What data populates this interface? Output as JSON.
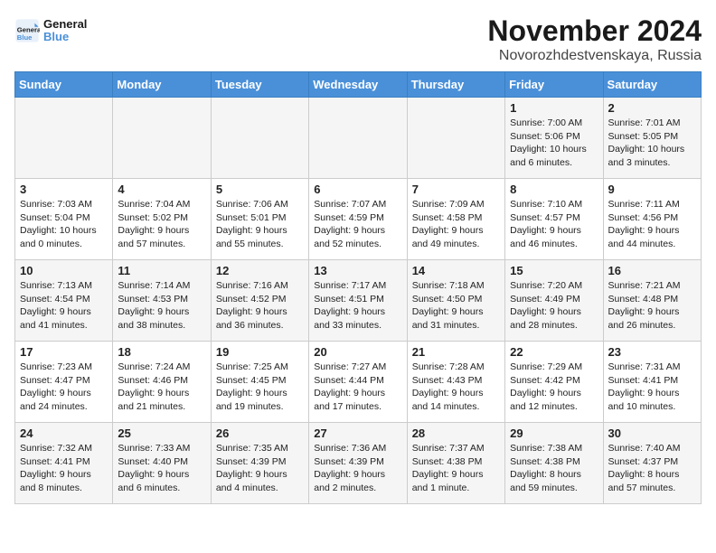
{
  "header": {
    "title": "November 2024",
    "subtitle": "Novorozhdestvenskaya, Russia",
    "logo_line1": "General",
    "logo_line2": "Blue"
  },
  "days_of_week": [
    "Sunday",
    "Monday",
    "Tuesday",
    "Wednesday",
    "Thursday",
    "Friday",
    "Saturday"
  ],
  "weeks": [
    [
      {
        "day": "",
        "info": ""
      },
      {
        "day": "",
        "info": ""
      },
      {
        "day": "",
        "info": ""
      },
      {
        "day": "",
        "info": ""
      },
      {
        "day": "",
        "info": ""
      },
      {
        "day": "1",
        "info": "Sunrise: 7:00 AM\nSunset: 5:06 PM\nDaylight: 10 hours\nand 6 minutes."
      },
      {
        "day": "2",
        "info": "Sunrise: 7:01 AM\nSunset: 5:05 PM\nDaylight: 10 hours\nand 3 minutes."
      }
    ],
    [
      {
        "day": "3",
        "info": "Sunrise: 7:03 AM\nSunset: 5:04 PM\nDaylight: 10 hours\nand 0 minutes."
      },
      {
        "day": "4",
        "info": "Sunrise: 7:04 AM\nSunset: 5:02 PM\nDaylight: 9 hours\nand 57 minutes."
      },
      {
        "day": "5",
        "info": "Sunrise: 7:06 AM\nSunset: 5:01 PM\nDaylight: 9 hours\nand 55 minutes."
      },
      {
        "day": "6",
        "info": "Sunrise: 7:07 AM\nSunset: 4:59 PM\nDaylight: 9 hours\nand 52 minutes."
      },
      {
        "day": "7",
        "info": "Sunrise: 7:09 AM\nSunset: 4:58 PM\nDaylight: 9 hours\nand 49 minutes."
      },
      {
        "day": "8",
        "info": "Sunrise: 7:10 AM\nSunset: 4:57 PM\nDaylight: 9 hours\nand 46 minutes."
      },
      {
        "day": "9",
        "info": "Sunrise: 7:11 AM\nSunset: 4:56 PM\nDaylight: 9 hours\nand 44 minutes."
      }
    ],
    [
      {
        "day": "10",
        "info": "Sunrise: 7:13 AM\nSunset: 4:54 PM\nDaylight: 9 hours\nand 41 minutes."
      },
      {
        "day": "11",
        "info": "Sunrise: 7:14 AM\nSunset: 4:53 PM\nDaylight: 9 hours\nand 38 minutes."
      },
      {
        "day": "12",
        "info": "Sunrise: 7:16 AM\nSunset: 4:52 PM\nDaylight: 9 hours\nand 36 minutes."
      },
      {
        "day": "13",
        "info": "Sunrise: 7:17 AM\nSunset: 4:51 PM\nDaylight: 9 hours\nand 33 minutes."
      },
      {
        "day": "14",
        "info": "Sunrise: 7:18 AM\nSunset: 4:50 PM\nDaylight: 9 hours\nand 31 minutes."
      },
      {
        "day": "15",
        "info": "Sunrise: 7:20 AM\nSunset: 4:49 PM\nDaylight: 9 hours\nand 28 minutes."
      },
      {
        "day": "16",
        "info": "Sunrise: 7:21 AM\nSunset: 4:48 PM\nDaylight: 9 hours\nand 26 minutes."
      }
    ],
    [
      {
        "day": "17",
        "info": "Sunrise: 7:23 AM\nSunset: 4:47 PM\nDaylight: 9 hours\nand 24 minutes."
      },
      {
        "day": "18",
        "info": "Sunrise: 7:24 AM\nSunset: 4:46 PM\nDaylight: 9 hours\nand 21 minutes."
      },
      {
        "day": "19",
        "info": "Sunrise: 7:25 AM\nSunset: 4:45 PM\nDaylight: 9 hours\nand 19 minutes."
      },
      {
        "day": "20",
        "info": "Sunrise: 7:27 AM\nSunset: 4:44 PM\nDaylight: 9 hours\nand 17 minutes."
      },
      {
        "day": "21",
        "info": "Sunrise: 7:28 AM\nSunset: 4:43 PM\nDaylight: 9 hours\nand 14 minutes."
      },
      {
        "day": "22",
        "info": "Sunrise: 7:29 AM\nSunset: 4:42 PM\nDaylight: 9 hours\nand 12 minutes."
      },
      {
        "day": "23",
        "info": "Sunrise: 7:31 AM\nSunset: 4:41 PM\nDaylight: 9 hours\nand 10 minutes."
      }
    ],
    [
      {
        "day": "24",
        "info": "Sunrise: 7:32 AM\nSunset: 4:41 PM\nDaylight: 9 hours\nand 8 minutes."
      },
      {
        "day": "25",
        "info": "Sunrise: 7:33 AM\nSunset: 4:40 PM\nDaylight: 9 hours\nand 6 minutes."
      },
      {
        "day": "26",
        "info": "Sunrise: 7:35 AM\nSunset: 4:39 PM\nDaylight: 9 hours\nand 4 minutes."
      },
      {
        "day": "27",
        "info": "Sunrise: 7:36 AM\nSunset: 4:39 PM\nDaylight: 9 hours\nand 2 minutes."
      },
      {
        "day": "28",
        "info": "Sunrise: 7:37 AM\nSunset: 4:38 PM\nDaylight: 9 hours\nand 1 minute."
      },
      {
        "day": "29",
        "info": "Sunrise: 7:38 AM\nSunset: 4:38 PM\nDaylight: 8 hours\nand 59 minutes."
      },
      {
        "day": "30",
        "info": "Sunrise: 7:40 AM\nSunset: 4:37 PM\nDaylight: 8 hours\nand 57 minutes."
      }
    ]
  ]
}
